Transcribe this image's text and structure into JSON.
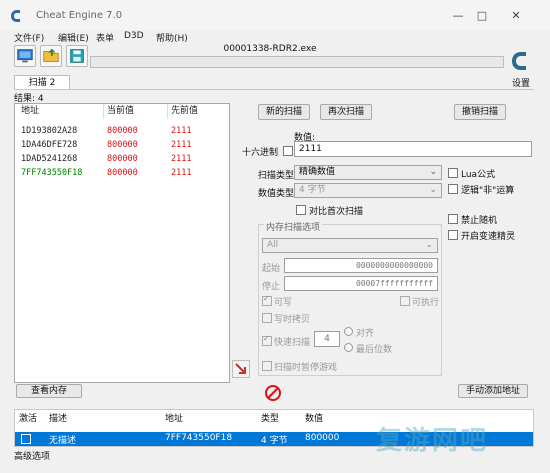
{
  "window": {
    "title": "Cheat Engine 7.0",
    "minimize": "—",
    "maximize": "□",
    "close": "✕"
  },
  "menu": {
    "file": "文件(F)",
    "edit": "编辑(E)",
    "table": "表单",
    "d3d": "D3D",
    "help": "帮助(H)"
  },
  "process": {
    "name": "00001338-RDR2.exe"
  },
  "settings_label": "设置",
  "tab": {
    "label": "扫描 2"
  },
  "results": {
    "label": "结果: 4"
  },
  "list": {
    "headers": {
      "address": "地址",
      "current": "当前值",
      "previous": "先前值"
    },
    "rows": [
      {
        "address": "1D193802A28",
        "current": "800000",
        "previous": "2111",
        "color": "#222222"
      },
      {
        "address": "1DA46DFE728",
        "current": "800000",
        "previous": "2111",
        "color": "#222222"
      },
      {
        "address": "1DAD5241268",
        "current": "800000",
        "previous": "2111",
        "color": "#222222"
      },
      {
        "address": "7FF743550F18",
        "current": "800000",
        "previous": "2111",
        "color": "#008000"
      }
    ]
  },
  "buttons": {
    "new_scan": "新的扫描",
    "next_scan": "再次扫描",
    "undo_scan": "撤销扫描",
    "view_memory": "查看内存",
    "add_address": "手动添加地址"
  },
  "value": {
    "label": "数值:",
    "hex_label": "十六进制",
    "input": "2111"
  },
  "scan_type": {
    "label": "扫描类型",
    "value": "精确数值"
  },
  "value_type": {
    "label": "数值类型",
    "value": "4 字节"
  },
  "compare_first": {
    "label": "对比首次扫描"
  },
  "options": {
    "lua": "Lua公式",
    "not": "逻辑\"非\"运算",
    "no_random": "禁止随机",
    "speedhack": "开启变速精灵"
  },
  "memory_group": {
    "title": "内存扫描选项",
    "region": "All",
    "start_label": "起始",
    "start_value": "0000000000000000",
    "stop_label": "停止",
    "stop_value": "00007fffffffffff",
    "writable": "可写",
    "executable": "可执行",
    "copy_on_write": "写时拷贝",
    "fast_scan": "快速扫描",
    "fast_value": "4",
    "align": "对齐",
    "last_digits": "最后位数",
    "pause": "扫描时暂停游戏"
  },
  "table": {
    "headers": {
      "active": "激活",
      "desc": "描述",
      "address": "地址",
      "type": "类型",
      "value": "数值"
    },
    "row": {
      "desc": "无描述",
      "address": "7FF743550F18",
      "type": "4 字节",
      "value": "800000"
    }
  },
  "status": {
    "advanced": "高级选项"
  },
  "watermark": "复游网吧"
}
